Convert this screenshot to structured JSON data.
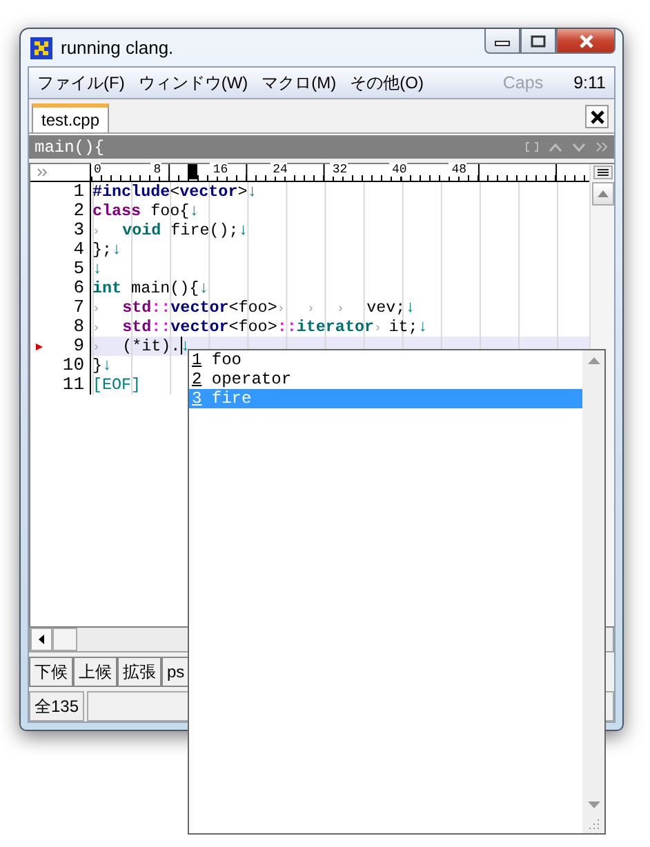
{
  "window": {
    "title": "running clang."
  },
  "menu": [
    {
      "label": "ファイル(F)"
    },
    {
      "label": "ウィンドウ(W)"
    },
    {
      "label": "マクロ(M)"
    },
    {
      "label": "その他(O)"
    }
  ],
  "indicators": {
    "caps": "Caps",
    "caps_on": false,
    "clock": "9:11"
  },
  "tabs": [
    {
      "label": "test.cpp",
      "selected": true
    }
  ],
  "function_bar": {
    "text": "main(){"
  },
  "ruler": {
    "labels": [
      "0",
      "8",
      "16",
      "24",
      "32",
      "40",
      "48"
    ]
  },
  "editor": {
    "lines": [
      {
        "number": "1",
        "current": false,
        "segments": [
          {
            "text": "#include",
            "kind": "directive"
          },
          {
            "text": "<",
            "kind": "plain"
          },
          {
            "text": "vector",
            "kind": "directive"
          },
          {
            "text": ">",
            "kind": "plain"
          },
          {
            "text": "↓",
            "kind": "eol"
          }
        ]
      },
      {
        "number": "2",
        "current": false,
        "segments": [
          {
            "text": "class",
            "kind": "keyword"
          },
          {
            "text": " foo{",
            "kind": "plain"
          },
          {
            "text": "↓",
            "kind": "eol"
          }
        ]
      },
      {
        "number": "3",
        "current": false,
        "segments": [
          {
            "text": "›",
            "kind": "tab"
          },
          {
            "text": "void",
            "kind": "type"
          },
          {
            "text": " fire();",
            "kind": "plain"
          },
          {
            "text": "↓",
            "kind": "eol"
          }
        ]
      },
      {
        "number": "4",
        "current": false,
        "segments": [
          {
            "text": "};",
            "kind": "plain"
          },
          {
            "text": "↓",
            "kind": "eol"
          }
        ]
      },
      {
        "number": "5",
        "current": false,
        "segments": [
          {
            "text": "↓",
            "kind": "eol"
          }
        ]
      },
      {
        "number": "6",
        "current": false,
        "segments": [
          {
            "text": "int",
            "kind": "type"
          },
          {
            "text": " main(){",
            "kind": "plain"
          },
          {
            "text": "↓",
            "kind": "eol"
          }
        ]
      },
      {
        "number": "7",
        "current": false,
        "segments": [
          {
            "text": "›",
            "kind": "tab"
          },
          {
            "text": "std",
            "kind": "keyword"
          },
          {
            "text": "::",
            "kind": "scope"
          },
          {
            "text": "vector",
            "kind": "directive"
          },
          {
            "text": "<foo>",
            "kind": "plain"
          },
          {
            "text": "›",
            "kind": "tab"
          },
          {
            "text": "›",
            "kind": "tab"
          },
          {
            "text": "›",
            "kind": "tab"
          },
          {
            "text": "vev;",
            "kind": "plain"
          },
          {
            "text": "↓",
            "kind": "eol"
          }
        ]
      },
      {
        "number": "8",
        "current": false,
        "segments": [
          {
            "text": "›",
            "kind": "tab"
          },
          {
            "text": "std",
            "kind": "keyword"
          },
          {
            "text": "::",
            "kind": "scope"
          },
          {
            "text": "vector",
            "kind": "directive"
          },
          {
            "text": "<foo>",
            "kind": "plain"
          },
          {
            "text": "::",
            "kind": "scope"
          },
          {
            "text": "iterator",
            "kind": "type"
          },
          {
            "text": "›",
            "kind": "tab"
          },
          {
            "text": "it;",
            "kind": "plain"
          },
          {
            "text": "↓",
            "kind": "eol"
          }
        ]
      },
      {
        "number": "9",
        "current": true,
        "segments": [
          {
            "text": "›",
            "kind": "tab"
          },
          {
            "text": "(*it).",
            "kind": "plain"
          },
          {
            "text": "↓",
            "kind": "eol"
          }
        ]
      },
      {
        "number": "10",
        "current": false,
        "segments": [
          {
            "text": "}",
            "kind": "plain"
          },
          {
            "text": "↓",
            "kind": "eol"
          }
        ]
      },
      {
        "number": "11",
        "current": false,
        "segments": [
          {
            "text": "[EOF]",
            "kind": "eof"
          }
        ]
      }
    ]
  },
  "toolbar": {
    "buttons": [
      "下候",
      "上候",
      "拡張",
      "ps"
    ]
  },
  "status_bar": {
    "cells": [
      "全135"
    ]
  },
  "completion": {
    "items": [
      {
        "key": "1",
        "label": "foo",
        "selected": false
      },
      {
        "key": "2",
        "label": "operator",
        "selected": false
      },
      {
        "key": "3",
        "label": "fire",
        "selected": true
      }
    ]
  }
}
